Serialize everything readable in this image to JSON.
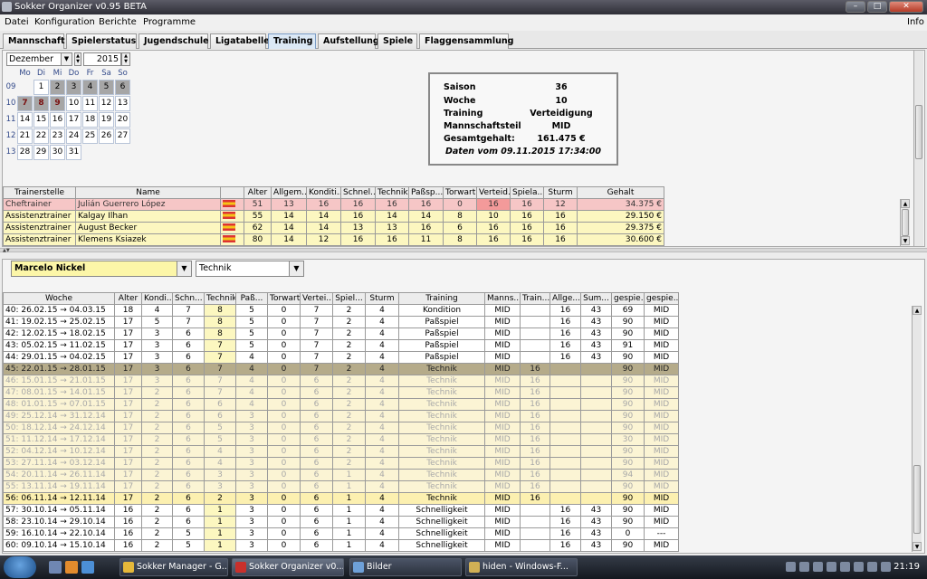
{
  "window": {
    "title": "Sokker Organizer v0.95 BETA",
    "minimize": "–",
    "maximize": "□",
    "close": "✕"
  },
  "menu": {
    "datei": "Datei",
    "konfiguration": "Konfiguration",
    "berichte": "Berichte",
    "programme": "Programme",
    "info": "Info"
  },
  "tabs": [
    "Mannschaft",
    "Spielerstatus",
    "Jugendschule",
    "Ligatabelle",
    "Training",
    "Aufstellung",
    "Spiele",
    "Flaggensammlung"
  ],
  "calendar": {
    "month": "Dezember",
    "year": "2015",
    "day_headers": [
      "Mo",
      "Di",
      "Mi",
      "Do",
      "Fr",
      "Sa",
      "So"
    ],
    "weeks": [
      {
        "wk": "09",
        "days": [
          "",
          "1",
          "2",
          "3",
          "4",
          "5",
          "6"
        ]
      },
      {
        "wk": "10",
        "days": [
          "7",
          "8",
          "9",
          "10",
          "11",
          "12",
          "13"
        ]
      },
      {
        "wk": "11",
        "days": [
          "14",
          "15",
          "16",
          "17",
          "18",
          "19",
          "20"
        ]
      },
      {
        "wk": "12",
        "days": [
          "21",
          "22",
          "23",
          "24",
          "25",
          "26",
          "27"
        ]
      },
      {
        "wk": "13",
        "days": [
          "28",
          "29",
          "30",
          "31",
          "",
          "",
          ""
        ]
      }
    ]
  },
  "info": {
    "saison_label": "Saison",
    "saison": "36",
    "woche_label": "Woche",
    "woche": "10",
    "training_label": "Training",
    "training": "Verteidigung",
    "team_label": "Mannschaftsteil",
    "team": "MID",
    "gehalt_label": "Gesamtgehalt:",
    "gehalt": "161.475 €",
    "daten": "Daten vom 09.11.2015 17:34:00"
  },
  "trainers": {
    "headers": [
      "Trainerstelle",
      "Name",
      "",
      "Alter",
      "Allgem...",
      "Konditi...",
      "Schnel...",
      "Technik",
      "Paßsp...",
      "Torwart",
      "Verteid...",
      "Spiela...",
      "Sturm",
      "Gehalt"
    ],
    "rows": [
      [
        "Cheftrainer",
        "Julián Guerrero López",
        "",
        "51",
        "13",
        "16",
        "16",
        "16",
        "16",
        "0",
        "16",
        "16",
        "12",
        "34.375 €"
      ],
      [
        "Assistenztrainer",
        "Kalgay Ilhan",
        "",
        "55",
        "14",
        "14",
        "16",
        "14",
        "14",
        "8",
        "10",
        "16",
        "16",
        "29.150 €"
      ],
      [
        "Assistenztrainer",
        "August Becker",
        "",
        "62",
        "14",
        "14",
        "13",
        "13",
        "16",
        "6",
        "16",
        "16",
        "16",
        "29.375 €"
      ],
      [
        "Assistenztrainer",
        "Klemens Ksiazek",
        "",
        "80",
        "14",
        "12",
        "16",
        "16",
        "11",
        "8",
        "16",
        "16",
        "16",
        "30.600 €"
      ]
    ]
  },
  "player_select": {
    "value": "Marcelo Nickel"
  },
  "skill_select": {
    "value": "Technik"
  },
  "grid": {
    "headers": [
      "Woche",
      "Alter",
      "Kondi...",
      "Schn...",
      "Technik",
      "Paß...",
      "Torwart",
      "Vertei...",
      "Spiel...",
      "Sturm",
      "Training",
      "Manns...",
      "Train...",
      "Allge...",
      "Sum...",
      "gespie...",
      "gespie..."
    ],
    "rows": [
      [
        "40: 26.02.15 → 04.03.15",
        "18",
        "4",
        "7",
        "8",
        "5",
        "0",
        "7",
        "2",
        "4",
        "Kondition",
        "MID",
        "",
        "16",
        "43",
        "69",
        "MID"
      ],
      [
        "41: 19.02.15 → 25.02.15",
        "17",
        "5",
        "7",
        "8",
        "5",
        "0",
        "7",
        "2",
        "4",
        "Paßspiel",
        "MID",
        "",
        "16",
        "43",
        "90",
        "MID"
      ],
      [
        "42: 12.02.15 → 18.02.15",
        "17",
        "3",
        "6",
        "8",
        "5",
        "0",
        "7",
        "2",
        "4",
        "Paßspiel",
        "MID",
        "",
        "16",
        "43",
        "90",
        "MID"
      ],
      [
        "43: 05.02.15 → 11.02.15",
        "17",
        "3",
        "6",
        "7",
        "5",
        "0",
        "7",
        "2",
        "4",
        "Paßspiel",
        "MID",
        "",
        "16",
        "43",
        "91",
        "MID"
      ],
      [
        "44: 29.01.15 → 04.02.15",
        "17",
        "3",
        "6",
        "7",
        "4",
        "0",
        "7",
        "2",
        "4",
        "Paßspiel",
        "MID",
        "",
        "16",
        "43",
        "90",
        "MID"
      ],
      [
        "45: 22.01.15 → 28.01.15",
        "17",
        "3",
        "6",
        "7",
        "4",
        "0",
        "7",
        "2",
        "4",
        "Technik",
        "MID",
        "16",
        "",
        "",
        "90",
        "MID"
      ],
      [
        "46: 15.01.15 → 21.01.15",
        "17",
        "3",
        "6",
        "7",
        "4",
        "0",
        "6",
        "2",
        "4",
        "Technik",
        "MID",
        "16",
        "",
        "",
        "90",
        "MID"
      ],
      [
        "47: 08.01.15 → 14.01.15",
        "17",
        "2",
        "6",
        "7",
        "4",
        "0",
        "6",
        "2",
        "4",
        "Technik",
        "MID",
        "16",
        "",
        "",
        "90",
        "MID"
      ],
      [
        "48: 01.01.15 → 07.01.15",
        "17",
        "2",
        "6",
        "6",
        "4",
        "0",
        "6",
        "2",
        "4",
        "Technik",
        "MID",
        "16",
        "",
        "",
        "90",
        "MID"
      ],
      [
        "49: 25.12.14 → 31.12.14",
        "17",
        "2",
        "6",
        "6",
        "3",
        "0",
        "6",
        "2",
        "4",
        "Technik",
        "MID",
        "16",
        "",
        "",
        "90",
        "MID"
      ],
      [
        "50: 18.12.14 → 24.12.14",
        "17",
        "2",
        "6",
        "5",
        "3",
        "0",
        "6",
        "2",
        "4",
        "Technik",
        "MID",
        "16",
        "",
        "",
        "90",
        "MID"
      ],
      [
        "51: 11.12.14 → 17.12.14",
        "17",
        "2",
        "6",
        "5",
        "3",
        "0",
        "6",
        "2",
        "4",
        "Technik",
        "MID",
        "16",
        "",
        "",
        "30",
        "MID"
      ],
      [
        "52: 04.12.14 → 10.12.14",
        "17",
        "2",
        "6",
        "4",
        "3",
        "0",
        "6",
        "2",
        "4",
        "Technik",
        "MID",
        "16",
        "",
        "",
        "90",
        "MID"
      ],
      [
        "53: 27.11.14 → 03.12.14",
        "17",
        "2",
        "6",
        "4",
        "3",
        "0",
        "6",
        "2",
        "4",
        "Technik",
        "MID",
        "16",
        "",
        "",
        "90",
        "MID"
      ],
      [
        "54: 20.11.14 → 26.11.14",
        "17",
        "2",
        "6",
        "3",
        "3",
        "0",
        "6",
        "1",
        "4",
        "Technik",
        "MID",
        "16",
        "",
        "",
        "94",
        "MID"
      ],
      [
        "55: 13.11.14 → 19.11.14",
        "17",
        "2",
        "6",
        "3",
        "3",
        "0",
        "6",
        "1",
        "4",
        "Technik",
        "MID",
        "16",
        "",
        "",
        "90",
        "MID"
      ],
      [
        "56: 06.11.14 → 12.11.14",
        "17",
        "2",
        "6",
        "2",
        "3",
        "0",
        "6",
        "1",
        "4",
        "Technik",
        "MID",
        "16",
        "",
        "",
        "90",
        "MID"
      ],
      [
        "57: 30.10.14 → 05.11.14",
        "16",
        "2",
        "6",
        "1",
        "3",
        "0",
        "6",
        "1",
        "4",
        "Schnelligkeit",
        "MID",
        "",
        "16",
        "43",
        "90",
        "MID"
      ],
      [
        "58: 23.10.14 → 29.10.14",
        "16",
        "2",
        "6",
        "1",
        "3",
        "0",
        "6",
        "1",
        "4",
        "Schnelligkeit",
        "MID",
        "",
        "16",
        "43",
        "90",
        "MID"
      ],
      [
        "59: 16.10.14 → 22.10.14",
        "16",
        "2",
        "5",
        "1",
        "3",
        "0",
        "6",
        "1",
        "4",
        "Schnelligkeit",
        "MID",
        "",
        "16",
        "43",
        "0",
        "---"
      ],
      [
        "60: 09.10.14 → 15.10.14",
        "16",
        "2",
        "5",
        "1",
        "3",
        "0",
        "6",
        "1",
        "4",
        "Schnelligkeit",
        "MID",
        "",
        "16",
        "43",
        "90",
        "MID"
      ]
    ]
  },
  "taskbar": {
    "items": [
      "Sokker Manager - G...",
      "Sokker Organizer v0....",
      "Bilder",
      "hiden - Windows-F..."
    ],
    "clock": "21:19"
  }
}
